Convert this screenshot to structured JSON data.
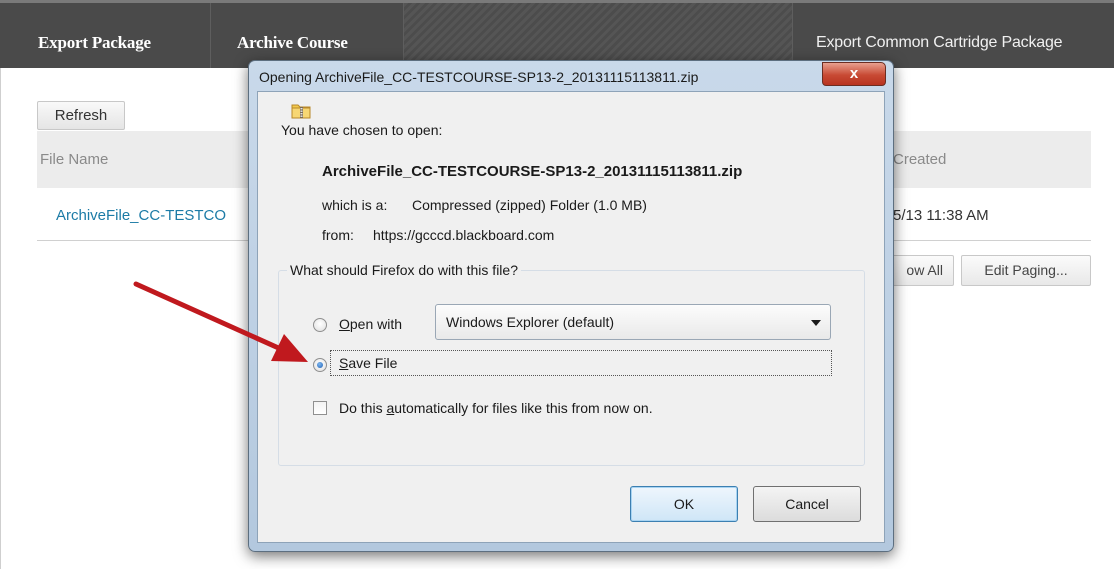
{
  "topbar": {
    "export_package": "Export Package",
    "archive_course": "Archive Course",
    "export_common": "Export Common Cartridge Package"
  },
  "toolbar": {
    "refresh": "Refresh"
  },
  "table": {
    "col_file": "File Name",
    "col_created": "Created",
    "row_file": "ArchiveFile_CC-TESTCO",
    "row_created": "5/13 11:38 AM"
  },
  "paging": {
    "show_all": "ow All",
    "edit_paging": "Edit Paging..."
  },
  "dialog": {
    "title": "Opening ArchiveFile_CC-TESTCOURSE-SP13-2_20131115113811.zip",
    "close": "x",
    "chosen_label": "You have chosen to open:",
    "filename": "ArchiveFile_CC-TESTCOURSE-SP13-2_20131115113811.zip",
    "which_is_label": "which is a:",
    "which_is_value": "Compressed (zipped) Folder (1.0 MB)",
    "from_label": "from:",
    "from_value": "https://gcccd.blackboard.com",
    "question": "What should Firefox do with this file?",
    "open_with_key": "O",
    "open_with_rest": "pen with",
    "open_with_app": "Windows Explorer (default)",
    "save_key": "S",
    "save_rest": "ave File",
    "auto_pre": "Do this ",
    "auto_key": "a",
    "auto_rest": "utomatically for files like this from now on.",
    "ok": "OK",
    "cancel": "Cancel"
  },
  "state": {
    "selected_option": "save_file",
    "auto_checked": false
  },
  "colors": {
    "link": "#1c7ba6",
    "topbar": "#4a4a4a",
    "arrow": "#c0191e",
    "close": "#c84a34"
  },
  "icons": {
    "file": "zip-folder-icon",
    "close": "close-icon",
    "dropdown": "chevron-down-icon"
  }
}
